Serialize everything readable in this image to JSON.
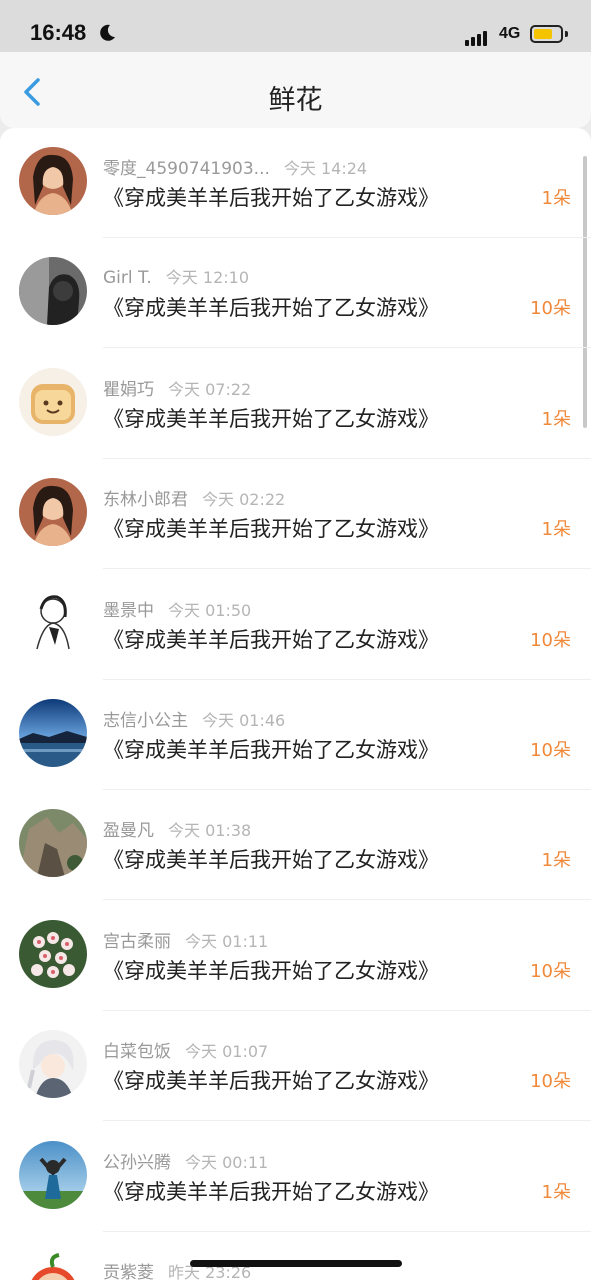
{
  "status_bar": {
    "time": "16:48",
    "network": "4G",
    "battery_color": "#f5c400"
  },
  "header": {
    "title": "鲜花",
    "back_icon": "chevron-left-icon",
    "accent_color": "#3a9be0"
  },
  "colors": {
    "count": "#f0893a",
    "username": "#999999",
    "timestamp": "#b5b5b5"
  },
  "items": [
    {
      "username": "零度_4590741903...",
      "time": "今天 14:24",
      "title": "《穿成美羊羊后我开始了乙女游戏》",
      "count": "1朵",
      "avatar": "portrait-woman-avatar"
    },
    {
      "username": "Girl T.",
      "time": "今天 12:10",
      "title": "《穿成美羊羊后我开始了乙女游戏》",
      "count": "10朵",
      "avatar": "dark-portrait-avatar"
    },
    {
      "username": "瞿娟巧",
      "time": "今天 07:22",
      "title": "《穿成美羊羊后我开始了乙女游戏》",
      "count": "1朵",
      "avatar": "toast-bread-avatar"
    },
    {
      "username": "东林小郎君",
      "time": "今天 02:22",
      "title": "《穿成美羊羊后我开始了乙女游戏》",
      "count": "1朵",
      "avatar": "portrait-woman-avatar"
    },
    {
      "username": "墨景中",
      "time": "今天 01:50",
      "title": "《穿成美羊羊后我开始了乙女游戏》",
      "count": "10朵",
      "avatar": "sketch-avatar"
    },
    {
      "username": "志信小公主",
      "time": "今天 01:46",
      "title": "《穿成美羊羊后我开始了乙女游戏》",
      "count": "10朵",
      "avatar": "landscape-lake-avatar"
    },
    {
      "username": "盈曼凡",
      "time": "今天 01:38",
      "title": "《穿成美羊羊后我开始了乙女游戏》",
      "count": "1朵",
      "avatar": "rock-cliff-avatar"
    },
    {
      "username": "宫古柔丽",
      "time": "今天 01:11",
      "title": "《穿成美羊羊后我开始了乙女游戏》",
      "count": "10朵",
      "avatar": "flowers-avatar"
    },
    {
      "username": "白菜包饭",
      "time": "今天 01:07",
      "title": "《穿成美羊羊后我开始了乙女游戏》",
      "count": "10朵",
      "avatar": "anime-character-avatar"
    },
    {
      "username": "公孙兴腾",
      "time": "今天 00:11",
      "title": "《穿成美羊羊后我开始了乙女游戏》",
      "count": "1朵",
      "avatar": "person-sky-avatar"
    },
    {
      "username": "贡紫菱",
      "time": "昨天 23:26",
      "title": "",
      "count": "",
      "avatar": "fruit-avatar"
    }
  ]
}
